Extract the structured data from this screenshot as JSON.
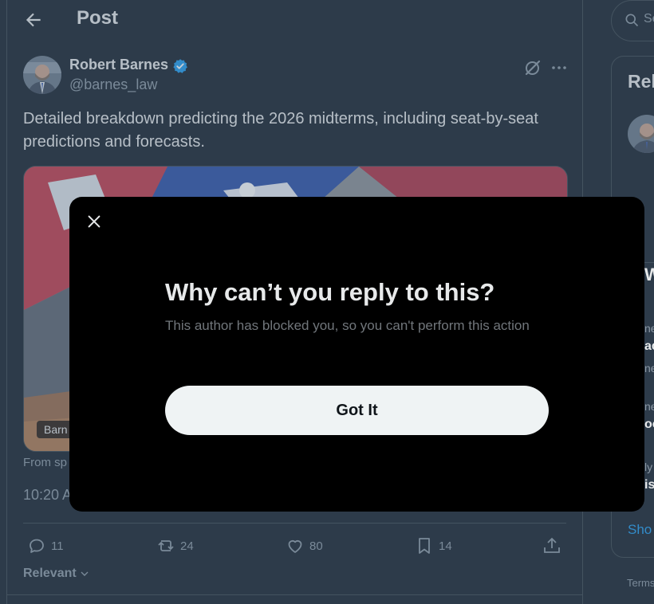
{
  "header": {
    "title": "Post"
  },
  "author": {
    "name": "Robert Barnes",
    "handle": "@barnes_law",
    "verified": true
  },
  "tweet": {
    "text": "Detailed breakdown predicting the 2026 midterms, including seat-by-seat predictions and forecasts.",
    "media_badge": "Barn",
    "from_text": "From sp",
    "timestamp": "10:20 A"
  },
  "actions": {
    "replies": "11",
    "reposts": "24",
    "likes": "80",
    "bookmarks": "14"
  },
  "sort": {
    "label": "Relevant"
  },
  "sidebar": {
    "search_placeholder": "Se",
    "related_title": "Rel",
    "trends_title": "Wh",
    "show_more": "Sho",
    "terms": "Terms",
    "trend_fragments": [
      "ne",
      "ac",
      "ne",
      "ne",
      "oo",
      "ly",
      "is"
    ]
  },
  "modal": {
    "title": "Why can’t you reply to this?",
    "body": "This author has blocked you, so you can't perform this action",
    "button_label": "Got It"
  },
  "colors": {
    "background": "#15202b",
    "modal_background": "#000000",
    "accent": "#1d9bf0",
    "button_background": "#eff3f4"
  }
}
